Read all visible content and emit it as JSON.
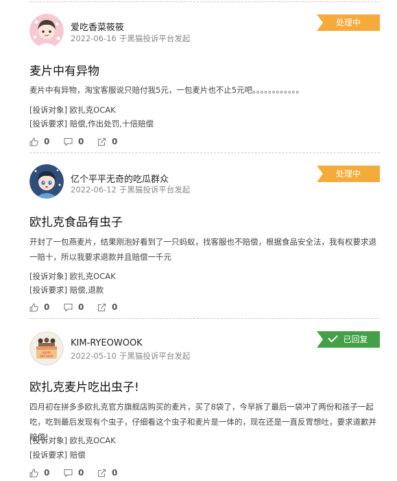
{
  "status_labels": {
    "processing": "处理中",
    "replied": "已回复"
  },
  "field_labels": {
    "target": "[投诉对象]",
    "demand": "[投诉要求]"
  },
  "complaints": [
    {
      "author": "爱吃香菜筱筱",
      "date": "2022-06-16",
      "via": "于黑猫投诉平台发起",
      "status": "处理中",
      "status_type": "processing",
      "title": "麦片中有异物",
      "body": "麦片中有异物，淘宝客服说只赔付我5元，一包麦片也不止5元吧。。。。。。。。。。。。",
      "target": "欧扎克OCAK",
      "demand": "赔偿,作出处罚,十倍赔偿",
      "likes": "0",
      "comments": "0",
      "shares": "0"
    },
    {
      "author": "亿个平平无奇的吃瓜群众",
      "date": "2022-06-12",
      "via": "于黑猫投诉平台发起",
      "status": "处理中",
      "status_type": "processing",
      "title": "欧扎克食品有虫子",
      "body": "开封了一包燕麦片，结果刚泡好看到了一只蚂蚁，找客服也不赔偿，根据食品安全法，我有权要求退一赔十，所以我要求退款并且赔偿一千元",
      "target": "欧扎克OCAK",
      "demand": "赔偿,退款",
      "likes": "0",
      "comments": "0",
      "shares": "0"
    },
    {
      "author": "KIM-RYEOWOOK",
      "date": "2022-05-10",
      "via": "于黑猫投诉平台发起",
      "status": "已回复",
      "status_type": "replied",
      "title": "欧扎克麦片吃出虫子!",
      "body": "四月初在拼多多欧扎克官方旗舰店购买的麦片，买了8袋了，今早拆了最后一袋冲了两份和孩子一起吃，吃到最后发现有个虫子，仔细看这个虫子和麦片是一体的，现在还是一直反胃想吐，要求道歉并赔偿!",
      "target": "欧扎克OCAK",
      "demand": "赔偿",
      "likes": "0",
      "comments": "0",
      "shares": "0"
    }
  ],
  "icons": {
    "like": "thumbs-up-icon",
    "comment": "comment-icon",
    "share": "share-icon",
    "check": "check-icon"
  },
  "colors": {
    "processing_badge": "#f5aa3c",
    "replied_badge": "#43a047",
    "divider": "#c8c8c8"
  }
}
